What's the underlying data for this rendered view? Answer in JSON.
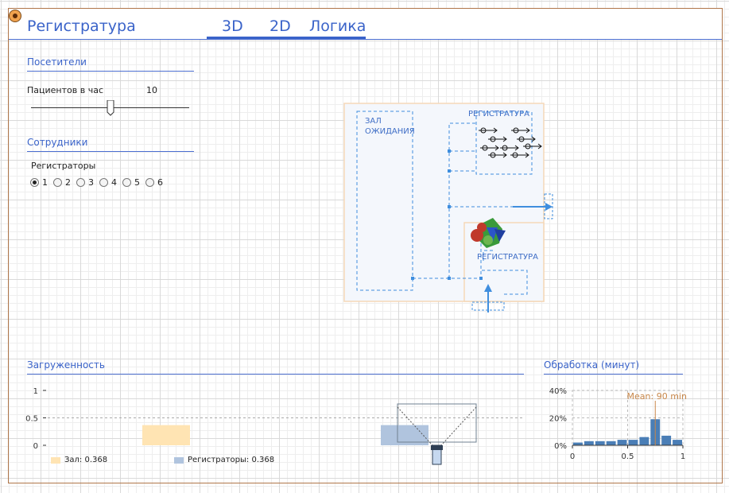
{
  "header": {
    "title": "Регистратура",
    "tabs": [
      {
        "label": "3D",
        "active": true
      },
      {
        "label": "2D",
        "active": true
      },
      {
        "label": "Логика",
        "active": true
      }
    ]
  },
  "visitors": {
    "section_title": "Посетители",
    "rate_label": "Пациентов в час",
    "rate_value": "10",
    "rate_fraction": 0.5
  },
  "staff": {
    "section_title": "Сотрудники",
    "group_label": "Регистраторы",
    "options": [
      "1",
      "2",
      "3",
      "4",
      "5",
      "6"
    ],
    "selected": "1"
  },
  "diagram": {
    "waiting_hall_line1": "ЗАЛ",
    "waiting_hall_line2": "ОЖИДАНИЯ",
    "reception_top": "РЕГИСТРАТУРА",
    "reception_bottom": "РЕГИСТРАТУРА"
  },
  "load": {
    "section_title": "Загруженность",
    "legend": [
      {
        "label": "Зал: 0.368",
        "color": "#ffe4b3"
      },
      {
        "label": "Регистраторы: 0.368",
        "color": "#b0c4de"
      }
    ]
  },
  "processing": {
    "section_title": "Обработка (минут)",
    "mean_label": "Mean: 90 min"
  },
  "chart_data": [
    {
      "type": "bar",
      "categories": [
        "Зал",
        "Регистраторы"
      ],
      "values": [
        0.368,
        0.368
      ],
      "ylim": [
        0,
        1
      ],
      "yticks": [
        "0",
        "0.5",
        "1"
      ],
      "reference_line": 0.5,
      "colors": [
        "#ffe4b3",
        "#b0c4de"
      ]
    },
    {
      "type": "bar",
      "x": [
        0.0,
        0.1,
        0.2,
        0.3,
        0.4,
        0.5,
        0.6,
        0.7,
        0.8,
        0.9
      ],
      "values": [
        2,
        3,
        3,
        3,
        4,
        4,
        6,
        19,
        7,
        4
      ],
      "unit": "%",
      "xlim": [
        0,
        1
      ],
      "ylim": [
        0,
        40
      ],
      "xticks": [
        "0",
        "0.5",
        "1"
      ],
      "yticks": [
        "0%",
        "20%",
        "40%"
      ],
      "mean_x": 0.75,
      "color": "#4a7eb6",
      "mean_color": "#c8874a"
    }
  ]
}
